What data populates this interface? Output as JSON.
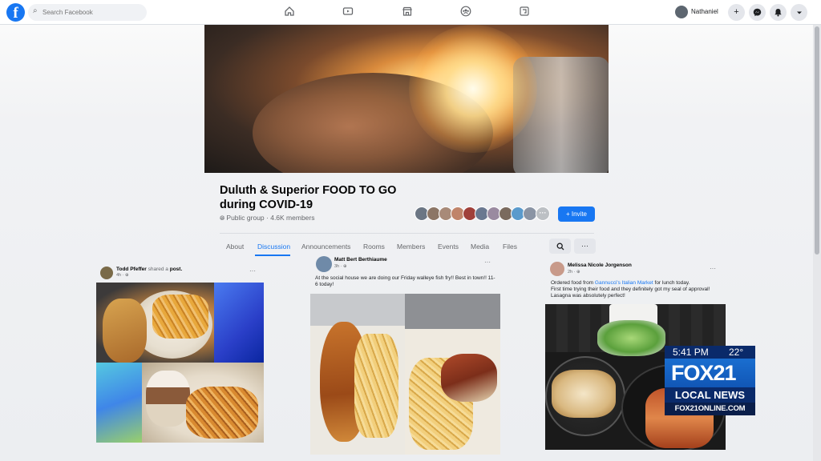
{
  "topbar": {
    "logo_glyph": "f",
    "search_placeholder": "Search Facebook",
    "nav_icons": [
      "home-icon",
      "watch-icon",
      "marketplace-icon",
      "groups-icon",
      "gaming-icon"
    ],
    "user_name": "Nathaniel",
    "action_icons": [
      "plus-icon",
      "messenger-icon",
      "notifications-icon",
      "chevron-down-icon"
    ],
    "brand_color": "#1877f2"
  },
  "group": {
    "title": "Duluth & Superior FOOD TO GO during COVID-19",
    "meta": "Public group · 4.6K members",
    "invite_label": "+ Invite",
    "tabs": [
      {
        "label": "About",
        "active": false
      },
      {
        "label": "Discussion",
        "active": true
      },
      {
        "label": "Announcements",
        "active": false
      },
      {
        "label": "Rooms",
        "active": false
      },
      {
        "label": "Members",
        "active": false
      },
      {
        "label": "Events",
        "active": false
      },
      {
        "label": "Media",
        "active": false
      },
      {
        "label": "Files",
        "active": false
      }
    ]
  },
  "posts": [
    {
      "author": "Todd Pfeffer",
      "action": "shared a",
      "object": "post.",
      "time": "4h · ⊕",
      "text": ""
    },
    {
      "author": "Matt Bert Berthiaume",
      "time": "3h · ⊕",
      "text": "At the social house we are doing our Friday walleye fish fry!! Best in town!! 11-6 today!"
    },
    {
      "author": "Melissa Nicole Jorgenson",
      "time": "2h · ⊕",
      "text_before_link": "Ordered food from ",
      "link": "Gannucci's Italian Market",
      "text_after_link": " for lunch today.",
      "text_line2": "First time trying their food and they definitely got my seal of approval!",
      "text_line3": "Lasagna was absolutely perfect!"
    }
  ],
  "overlay": {
    "time": "5:41 PM",
    "temperature": "22°",
    "station": "FOX21",
    "news": "LOCAL NEWS",
    "url": "FOX21ONLINE.COM"
  }
}
